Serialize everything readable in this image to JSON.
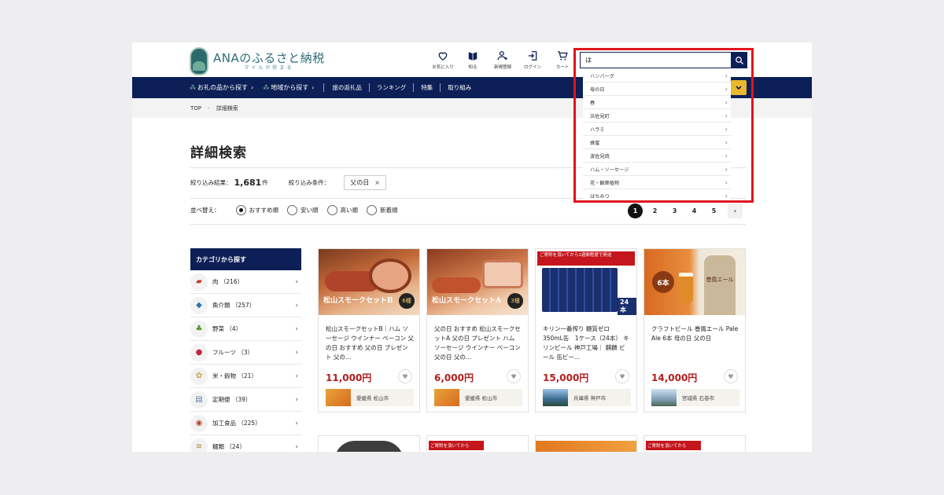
{
  "header": {
    "logo_title": "ANAのふるさと納税",
    "logo_sub": "マイルが貯まる",
    "icons": [
      {
        "name": "お気に入り",
        "icon": "heart-icon"
      },
      {
        "name": "知る",
        "icon": "book-icon"
      },
      {
        "name": "新規登録",
        "icon": "user-plus-icon"
      },
      {
        "name": "ログイン",
        "icon": "login-icon"
      },
      {
        "name": "カート",
        "icon": "cart-icon"
      }
    ]
  },
  "nav": {
    "find_item": "お礼の品から探す",
    "find_region": "地域から探す",
    "links": [
      "旅の返礼品",
      "ランキング",
      "特集",
      "取り組み"
    ]
  },
  "breadcrumb": {
    "top": "TOP",
    "current": "詳細検索"
  },
  "page_title": "詳細検索",
  "results": {
    "label": "絞り込み結果：",
    "count": "1,681",
    "unit": "件",
    "filter_label": "絞り込み条件：",
    "filter_chip": "父の日",
    "filter_remove": "×"
  },
  "sort": {
    "label": "並べ替え：",
    "options": [
      "おすすめ順",
      "安い順",
      "高い順",
      "新着順"
    ],
    "selected": "おすすめ順"
  },
  "pager": {
    "pages": [
      "1",
      "2",
      "3",
      "4",
      "5"
    ],
    "current": "1",
    "next": "›"
  },
  "sidebar": {
    "heading": "カテゴリから探す",
    "items": [
      {
        "label": "肉 （216）",
        "icon": "meat-icon"
      },
      {
        "label": "魚介類 （257）",
        "icon": "fish-icon"
      },
      {
        "label": "野菜 （4）",
        "icon": "vegetable-icon"
      },
      {
        "label": "フルーツ （3）",
        "icon": "fruit-icon"
      },
      {
        "label": "米・穀物 （21）",
        "icon": "rice-icon"
      },
      {
        "label": "定期便 （39）",
        "icon": "subscription-icon"
      },
      {
        "label": "加工食品 （225）",
        "icon": "processed-food-icon"
      },
      {
        "label": "麺類 （24）",
        "icon": "noodle-icon"
      }
    ]
  },
  "products": [
    {
      "title": "松山スモークセットB｜ハム ソーセージ ウインナー ベーコン 父の日 おすすめ 父の日 プレゼント 父の…",
      "price": "11,000円",
      "location": "愛媛県 松山市",
      "image_caption": "松山スモークセットB",
      "image_badge": "6種"
    },
    {
      "title": "父の日 おすすめ 松山スモークセットA 父の日 プレゼント ハム ソーセージ ウインナー ベーコン 父の日 父の…",
      "price": "6,000円",
      "location": "愛媛県 松山市",
      "image_caption": "松山スモークセットA",
      "image_badge": "3種"
    },
    {
      "title": "キリン一番搾り 糖質ゼロ 350mL缶　1ケース（24本） キリンビール 神戸工場｜ 麒麟 ビール 缶ビー…",
      "price": "15,000円",
      "location": "兵庫県 神戸市",
      "image_caption": "ご寄附を頂いてから1週間程度で発送",
      "image_badge": "24本"
    },
    {
      "title": "クラフトビール 巻風エール Pale Ale 6本 母の日 父の日",
      "price": "14,000円",
      "location": "宮城県 石巻市",
      "image_caption": "巻風エール",
      "image_badge": "6本"
    }
  ],
  "more_cards": [
    {
      "caption": ""
    },
    {
      "caption": "ご寄附を頂いてから"
    },
    {
      "caption": ""
    },
    {
      "caption": "ご寄附を頂いてから"
    }
  ],
  "search": {
    "query": "は",
    "suggestions": [
      "ハンバーグ",
      "母の日",
      "春",
      "浜佐見町",
      "ハラミ",
      "蜂蜜",
      "波佐見焼",
      "ハム・ソーセージ",
      "花・観葉植物",
      "はちみつ"
    ]
  },
  "colors": {
    "navy": "#0d1f57",
    "price_red": "#b21c1c",
    "highlight_frame": "#e0151c",
    "accent_yellow": "#e9b82e"
  }
}
